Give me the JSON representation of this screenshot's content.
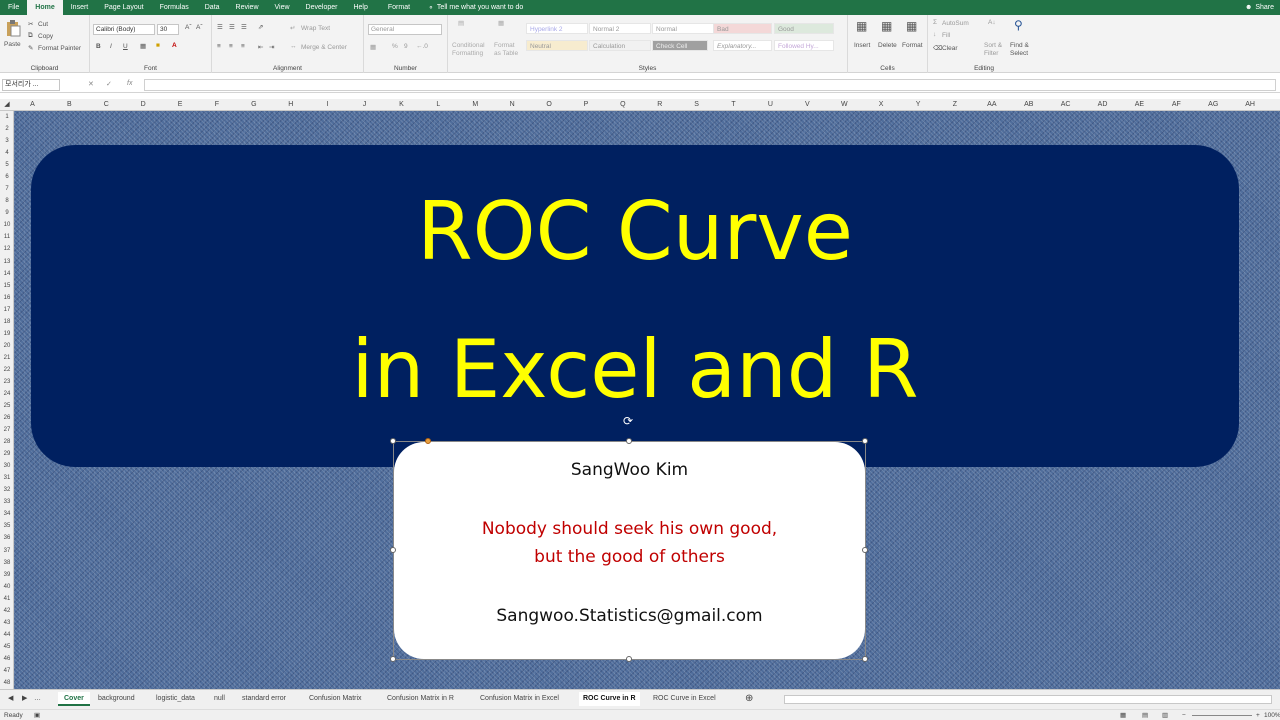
{
  "ribbon_tabs": [
    "File",
    "Home",
    "Insert",
    "Page Layout",
    "Formulas",
    "Data",
    "Review",
    "View",
    "Developer",
    "Help",
    "Format"
  ],
  "active_tab": "Home",
  "tell_me": "Tell me what you want to do",
  "share": "Share",
  "clipboard": {
    "paste": "Paste",
    "cut": "Cut",
    "copy": "Copy",
    "format_painter": "Format Painter",
    "label": "Clipboard"
  },
  "font": {
    "name": "Calibri (Body)",
    "size": "30",
    "label": "Font",
    "bold": "B",
    "italic": "I",
    "underline": "U"
  },
  "alignment": {
    "wrap_text": "Wrap Text",
    "merge_center": "Merge & Center",
    "label": "Alignment"
  },
  "number": {
    "format": "General",
    "label": "Number",
    "percent": "%",
    "comma": "9"
  },
  "styles": {
    "conditional_formatting": "Conditional Formatting",
    "format_as_table": "Format as Table",
    "cells": [
      "Hyperlink 2",
      "Normal 2",
      "Normal",
      "Bad",
      "Good",
      "Neutral",
      "Calculation",
      "Check Cell",
      "Explanatory...",
      "Followed Hy..."
    ],
    "label": "Styles"
  },
  "cells": {
    "insert": "Insert",
    "delete": "Delete",
    "format": "Format",
    "label": "Cells"
  },
  "editing": {
    "autosum": "AutoSum",
    "fill": "Fill",
    "clear": "Clear",
    "sort_filter": "Sort & Filter",
    "find_select": "Find & Select",
    "label": "Editing"
  },
  "formula_bar": {
    "name_box": "모서리가 ...",
    "fx": "fx",
    "cancel": "✕",
    "enter": "✓"
  },
  "columns": [
    "A",
    "B",
    "C",
    "D",
    "E",
    "F",
    "G",
    "H",
    "I",
    "J",
    "K",
    "L",
    "M",
    "N",
    "O",
    "P",
    "Q",
    "R",
    "S",
    "T",
    "U",
    "V",
    "W",
    "X",
    "Y",
    "Z",
    "AA",
    "AB",
    "AC",
    "AD",
    "AE",
    "AF",
    "AG",
    "AH"
  ],
  "rows": [
    "1",
    "2",
    "3",
    "4",
    "5",
    "6",
    "7",
    "8",
    "9",
    "10",
    "11",
    "12",
    "13",
    "14",
    "15",
    "16",
    "17",
    "18",
    "19",
    "20",
    "21",
    "22",
    "23",
    "24",
    "25",
    "26",
    "27",
    "28",
    "29",
    "30",
    "31",
    "32",
    "33",
    "34",
    "35",
    "36",
    "37",
    "38",
    "39",
    "40",
    "41",
    "42",
    "43",
    "44",
    "45",
    "46",
    "47",
    "48"
  ],
  "title": {
    "line1": "ROC Curve",
    "line2": "in Excel and R"
  },
  "info": {
    "author": "SangWoo Kim",
    "quote_line1": "Nobody should seek his own good,",
    "quote_line2": "but the good of others",
    "email": "Sangwoo.Statistics@gmail.com"
  },
  "sheets": [
    "Cover",
    "background",
    "logistic_data",
    "null",
    "standard error",
    "Confusion Matrix",
    "Confusion Matrix in R",
    "Confusion Matrix in Excel",
    "ROC Curve in R",
    "ROC Curve in Excel"
  ],
  "active_sheet": "ROC Curve in R",
  "status": {
    "ready": "Ready",
    "zoom": "100%"
  },
  "colors": {
    "excel_green": "#217346",
    "title_bg": "#002060",
    "title_text": "#ffff00",
    "quote": "#c00000"
  }
}
